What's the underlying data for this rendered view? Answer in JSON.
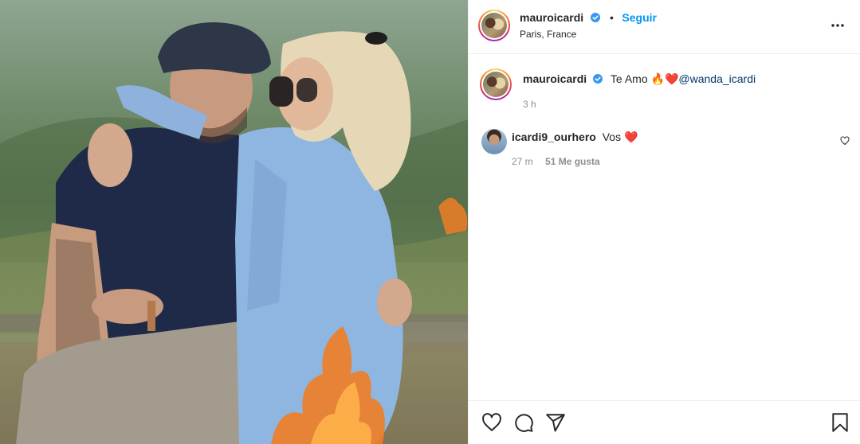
{
  "post": {
    "author": {
      "username": "mauroicardi",
      "verified_icon": "verified-badge-icon",
      "follow_label": "Seguir",
      "separator": "•",
      "location": "Paris, France"
    },
    "caption": {
      "username": "mauroicardi",
      "text": "Te Amo ",
      "emoji": "🔥❤️",
      "mention": "@wanda_icardi",
      "time": "3 h"
    },
    "comments": [
      {
        "username": "icardi9_ourhero",
        "text": "Vos ",
        "emoji": "❤️",
        "time": "27 m",
        "likes": "51 Me gusta"
      }
    ],
    "actions": {
      "icons": [
        "heart-icon",
        "comment-icon",
        "share-icon",
        "bookmark-icon"
      ]
    }
  },
  "colors": {
    "link_blue": "#0095f6",
    "verified_blue": "#3897f0",
    "secondary_text": "#8e8e8e",
    "divider": "#efefef"
  }
}
